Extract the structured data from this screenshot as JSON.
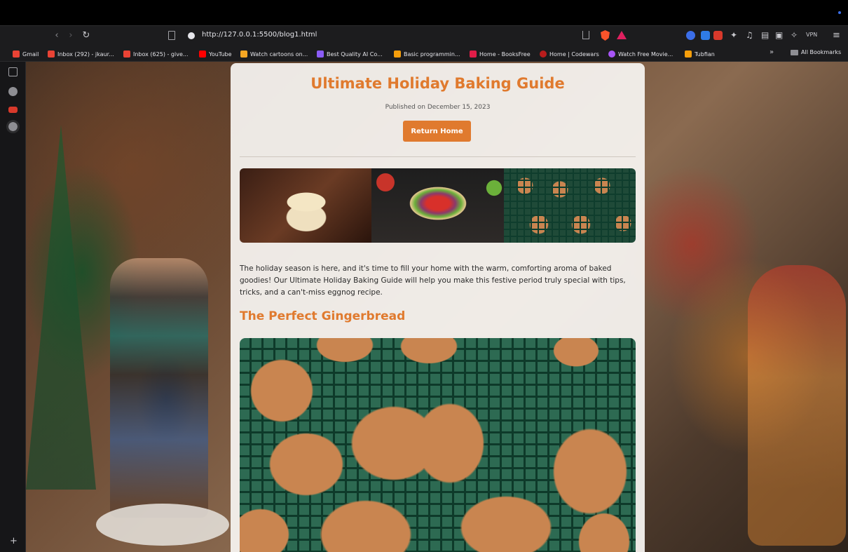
{
  "browser": {
    "url": "http://127.0.0.1:5500/blog1.html",
    "vpn_label": "VPN"
  },
  "bookmarks": [
    {
      "label": "Gmail",
      "color": "#ea4335"
    },
    {
      "label": "Inbox (292) - jkaur...",
      "color": "#ea4335"
    },
    {
      "label": "Inbox (625) - give...",
      "color": "#ea4335"
    },
    {
      "label": "YouTube",
      "color": "#ff0000"
    },
    {
      "label": "Watch cartoons on...",
      "color": "#f5a623"
    },
    {
      "label": "Best Quality AI Co...",
      "color": "#8b5cf6"
    },
    {
      "label": "Basic programmin...",
      "color": "#f59e0b"
    },
    {
      "label": "Home - BooksFree",
      "color": "#e11d48"
    },
    {
      "label": "Home | Codewars",
      "color": "#b91c1c"
    },
    {
      "label": "Watch Free Movie...",
      "color": "#a855f7"
    },
    {
      "label": "Tubfian",
      "color": "#f59e0b"
    }
  ],
  "bookmarks_more": "»",
  "all_bookmarks": "All Bookmarks",
  "page": {
    "title": "Ultimate Holiday Baking Guide",
    "published": "Published on December 15, 2023",
    "return_button": "Return Home",
    "intro": "The holiday season is here, and it's time to fill your home with the warm, comforting aroma of baked goodies! Our Ultimate Holiday Baking Guide will help you make this festive period truly special with tips, tricks, and a can't-miss eggnog recipe.",
    "section_heading": "The Perfect Gingerbread"
  },
  "colors": {
    "accent": "#e07a2e",
    "card_bg": "#f8f5f2"
  }
}
